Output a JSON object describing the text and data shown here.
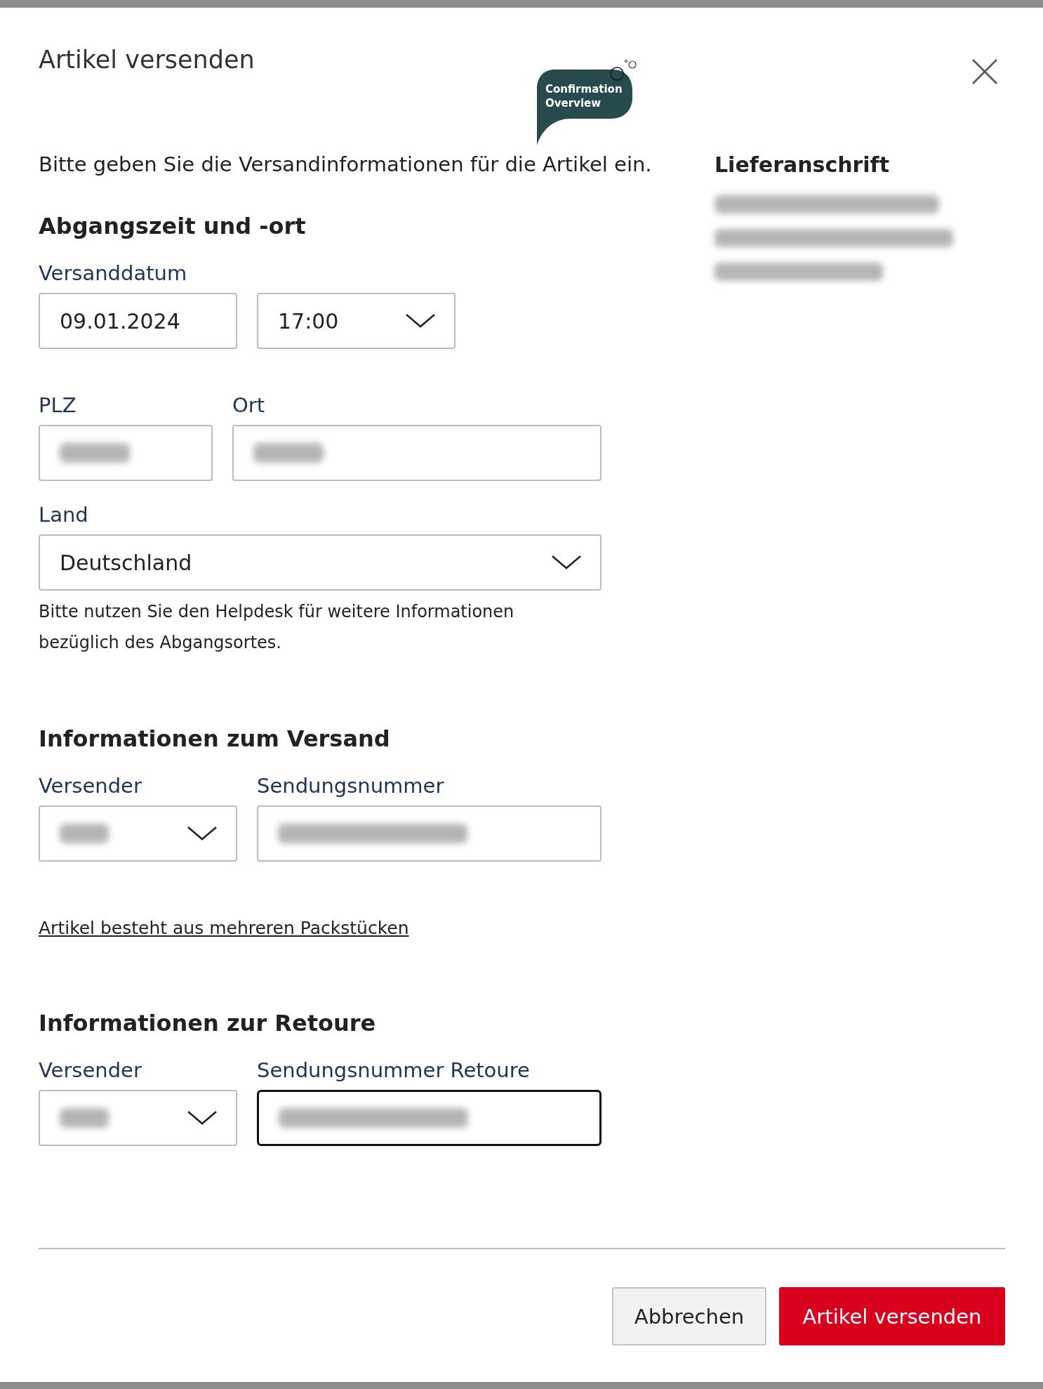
{
  "dialog": {
    "title": "Artikel versenden",
    "badge": "Confirmation Overview",
    "intro": "Bitte geben Sie die Versandinformationen für die Artikel ein.",
    "sections": [
      {
        "heading": "Abgangszeit und -ort",
        "rows": [
          {
            "fields": [
              {
                "label": "Versanddatum",
                "kind": "text",
                "value": "09.01.2024",
                "redacted": false,
                "focused": false
              },
              {
                "kind": "select",
                "value": "17:00",
                "redacted": false,
                "focused": false
              }
            ]
          },
          {
            "fields": [
              {
                "label": "PLZ",
                "kind": "text",
                "redacted": true,
                "focused": false
              },
              {
                "label": "Ort",
                "kind": "text",
                "redacted": true,
                "focused": false
              }
            ]
          },
          {
            "fields": [
              {
                "label": "Land",
                "kind": "select",
                "value": "Deutschland",
                "redacted": false,
                "focused": false
              }
            ]
          }
        ],
        "help": "Bitte nutzen Sie den Helpdesk für weitere Informationen bezüglich des Abgangsortes."
      },
      {
        "heading": "Informationen zum Versand",
        "rows": [
          {
            "fields": [
              {
                "label": "Versender",
                "kind": "select",
                "redacted": true,
                "focused": false
              },
              {
                "label": "Sendungsnummer",
                "kind": "text",
                "redacted": true,
                "focused": false
              }
            ]
          }
        ],
        "link": "Artikel besteht aus mehreren Packstücken"
      },
      {
        "heading": "Informationen zur Retoure",
        "rows": [
          {
            "fields": [
              {
                "label": "Versender",
                "kind": "select",
                "redacted": true,
                "focused": false
              },
              {
                "label": "Sendungsnummer Retoure",
                "kind": "text",
                "redacted": true,
                "focused": true
              }
            ]
          }
        ]
      }
    ],
    "address": {
      "heading": "Lieferanschrift",
      "lines": [
        {
          "redacted": true
        },
        {
          "redacted": true
        },
        {
          "redacted": true
        }
      ]
    },
    "buttons": [
      {
        "label": "Abbrechen",
        "kind": "secondary"
      },
      {
        "label": "Artikel versenden",
        "kind": "primary"
      }
    ]
  }
}
